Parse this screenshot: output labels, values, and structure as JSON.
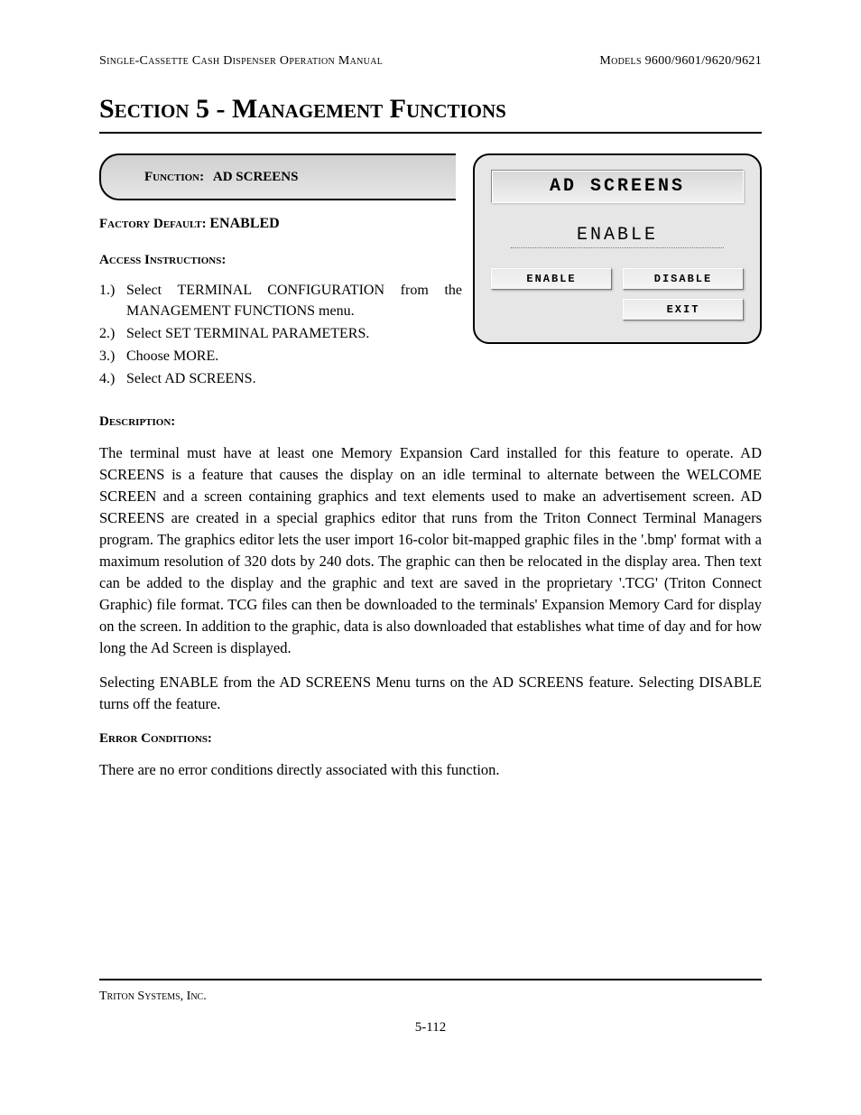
{
  "header": {
    "left": "Single-Cassette Cash Dispenser Operation Manual",
    "right": "Models 9600/9601/9620/9621"
  },
  "section_title": "Section 5 - Management Functions",
  "function": {
    "label": "Function:",
    "name": "AD SCREENS"
  },
  "factory_default": {
    "label": "Factory Default:",
    "value": "ENABLED"
  },
  "access": {
    "label": "Access Instructions:",
    "steps": [
      "Select TERMINAL CONFIGURATION from the MANAGEMENT FUNCTIONS menu.",
      "Select SET TERMINAL PARAMETERS.",
      "Choose MORE.",
      "Select AD SCREENS."
    ]
  },
  "screen": {
    "title": "AD SCREENS",
    "status": "ENABLE",
    "buttons": {
      "enable": "ENABLE",
      "disable": "DISABLE",
      "exit": "EXIT"
    }
  },
  "description": {
    "label": "Description:",
    "p1": "The terminal must have at least one Memory Expansion Card installed for this feature to operate. AD SCREENS is a feature that causes the display on an idle terminal to alternate between the WELCOME SCREEN and a screen containing graphics and text elements used to make an advertisement screen.  AD SCREENS are created in a special graphics editor that runs from the Triton Connect Terminal Managers program.  The graphics editor lets the user import 16-color bit-mapped graphic files in the '.bmp' format with a maximum resolution of 320 dots by 240 dots.  The graphic can then be relocated in the display area.  Then text can be added to the display and the graphic and text are saved in the proprietary '.TCG' (Triton Connect Graphic) file format.  TCG files can then be downloaded to the terminals' Expansion Memory Card for display on the screen.  In addition to the graphic, data is also downloaded that establishes what time of day and for how long the Ad Screen is displayed.",
    "p2": "Selecting ENABLE from the AD SCREENS Menu turns on the AD SCREENS feature. Selecting DISABLE turns off the feature."
  },
  "errors": {
    "label": "Error Conditions:",
    "text": "There are no error conditions directly associated with this function."
  },
  "footer": {
    "company": "Triton Systems, Inc.",
    "page": "5-112"
  }
}
